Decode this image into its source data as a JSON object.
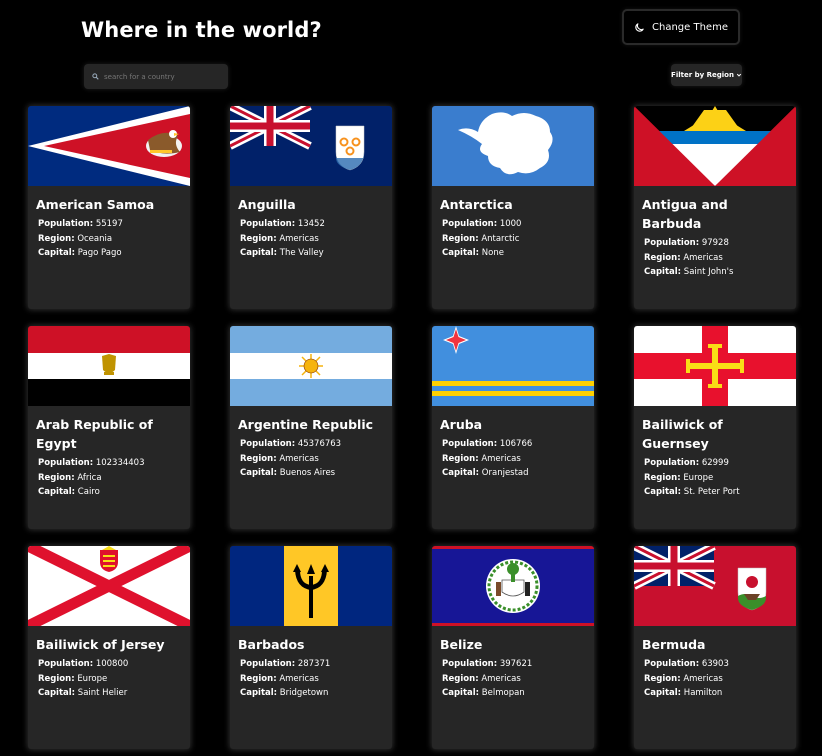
{
  "header": {
    "title": "Where in the world?",
    "theme_button_label": "Change Theme"
  },
  "search": {
    "placeholder": "search for a country",
    "value": ""
  },
  "filter": {
    "label": "Filter by Region"
  },
  "labels": {
    "population": "Population:",
    "region": "Region:",
    "capital": "Capital:"
  },
  "countries": [
    {
      "name": "American Samoa",
      "population": "55197",
      "region": "Oceania",
      "capital": "Pago Pago"
    },
    {
      "name": "Anguilla",
      "population": "13452",
      "region": "Americas",
      "capital": "The Valley"
    },
    {
      "name": "Antarctica",
      "population": "1000",
      "region": "Antarctic",
      "capital": "None"
    },
    {
      "name": "Antigua and Barbuda",
      "population": "97928",
      "region": "Americas",
      "capital": "Saint John's"
    },
    {
      "name": "Arab Republic of Egypt",
      "population": "102334403",
      "region": "Africa",
      "capital": "Cairo"
    },
    {
      "name": "Argentine Republic",
      "population": "45376763",
      "region": "Americas",
      "capital": "Buenos Aires"
    },
    {
      "name": "Aruba",
      "population": "106766",
      "region": "Americas",
      "capital": "Oranjestad"
    },
    {
      "name": "Bailiwick of Guernsey",
      "population": "62999",
      "region": "Europe",
      "capital": "St. Peter Port"
    },
    {
      "name": "Bailiwick of Jersey",
      "population": "100800",
      "region": "Europe",
      "capital": "Saint Helier"
    },
    {
      "name": "Barbados",
      "population": "287371",
      "region": "Americas",
      "capital": "Bridgetown"
    },
    {
      "name": "Belize",
      "population": "397621",
      "region": "Americas",
      "capital": "Belmopan"
    },
    {
      "name": "Bermuda",
      "population": "63903",
      "region": "Americas",
      "capital": "Hamilton"
    }
  ]
}
